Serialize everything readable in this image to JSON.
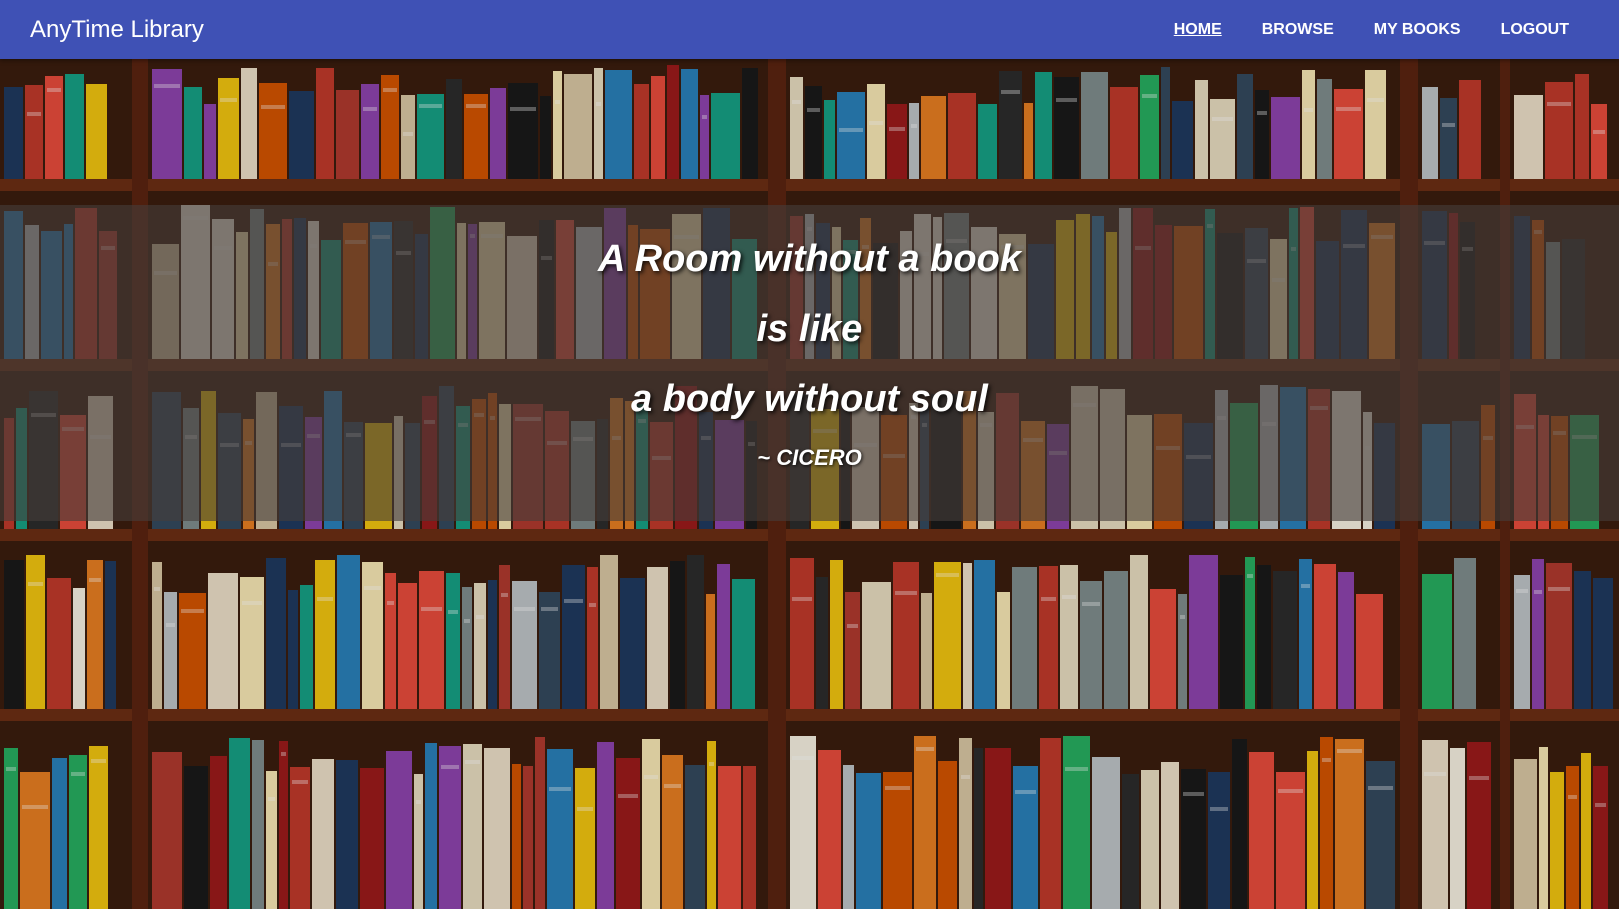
{
  "navbar": {
    "brand": "AnyTime Library",
    "links": [
      {
        "label": "HOME",
        "active": true
      },
      {
        "label": "BROWSE",
        "active": false
      },
      {
        "label": "MY BOOKS",
        "active": false
      },
      {
        "label": "LOGOUT",
        "active": false
      }
    ],
    "background_color": "#3f51b5"
  },
  "hero": {
    "image_description_icon": "bookshelf-background",
    "quote": {
      "line1": "A Room without a book",
      "line2": "is like",
      "line3": "a body without soul",
      "author": "~ CICERO"
    }
  }
}
